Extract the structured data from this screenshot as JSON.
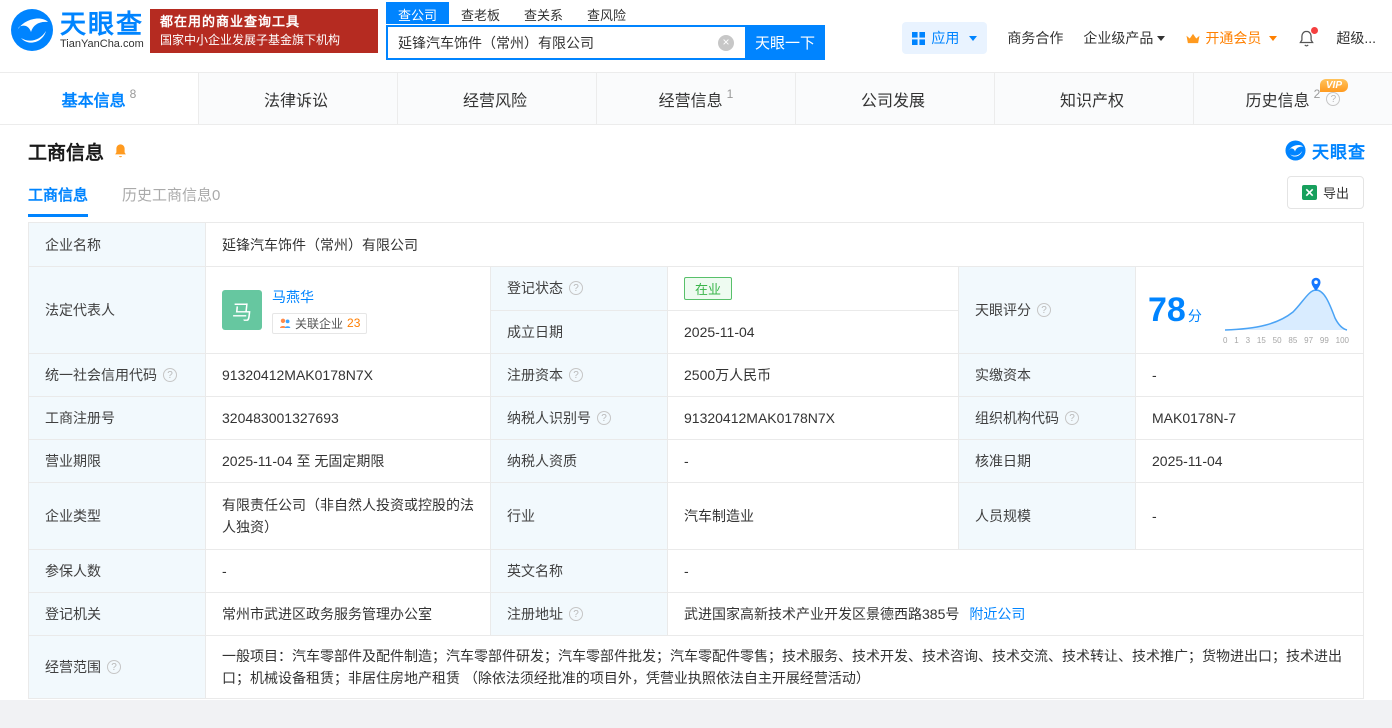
{
  "colors": {
    "brand_blue": "#0084ff",
    "slogan_red": "#b52b21",
    "vip_orange": "#ff9a1f",
    "status_green": "#39b54a"
  },
  "brand": {
    "name": "天眼查",
    "domain": "TianYanCha.com",
    "slogan1": "都在用的商业查询工具",
    "slogan2": "国家中小企业发展子基金旗下机构"
  },
  "search": {
    "tabs": [
      "查公司",
      "查老板",
      "查关系",
      "查风险"
    ],
    "value": "延锋汽车饰件（常州）有限公司",
    "button": "天眼一下"
  },
  "topnav": {
    "app": "应用",
    "cooperation": "商务合作",
    "enterprise": "企业级产品",
    "vip": "开通会员",
    "super": "超级..."
  },
  "tabs": [
    {
      "label": "基本信息",
      "count": "8"
    },
    {
      "label": "法律诉讼",
      "count": ""
    },
    {
      "label": "经营风险",
      "count": ""
    },
    {
      "label": "经营信息",
      "count": "1"
    },
    {
      "label": "公司发展",
      "count": ""
    },
    {
      "label": "知识产权",
      "count": ""
    },
    {
      "label": "历史信息",
      "count": "2",
      "vip": "VIP"
    }
  ],
  "section": {
    "title": "工商信息",
    "brand": "天眼查",
    "subtab_active": "工商信息",
    "subtab_history": "历史工商信息0",
    "export": "导出"
  },
  "info": {
    "company_name_label": "企业名称",
    "company_name": "延锋汽车饰件（常州）有限公司",
    "legal_rep_label": "法定代表人",
    "legal_rep_avatar": "马",
    "legal_rep_name": "马燕华",
    "related_label": "关联企业",
    "related_count": "23",
    "reg_status_label": "登记状态",
    "reg_status": "在业",
    "establish_label": "成立日期",
    "establish_date": "2025-11-04",
    "score_label": "天眼评分",
    "score": "78",
    "score_suffix": "分",
    "score_axis": [
      "0",
      "1",
      "3",
      "15",
      "50",
      "85",
      "97",
      "99",
      "100"
    ],
    "credit_code_label": "统一社会信用代码",
    "credit_code": "91320412MAK0178N7X",
    "reg_capital_label": "注册资本",
    "reg_capital": "2500万人民币",
    "paid_capital_label": "实缴资本",
    "paid_capital": "-",
    "reg_number_label": "工商注册号",
    "reg_number": "320483001327693",
    "taxpayer_id_label": "纳税人识别号",
    "taxpayer_id": "91320412MAK0178N7X",
    "org_code_label": "组织机构代码",
    "org_code": "MAK0178N-7",
    "term_label": "营业期限",
    "term": "2025-11-04 至 无固定期限",
    "taxpayer_quality_label": "纳税人资质",
    "taxpayer_quality": "-",
    "approval_label": "核准日期",
    "approval_date": "2025-11-04",
    "type_label": "企业类型",
    "company_type": "有限责任公司（非自然人投资或控股的法人独资）",
    "industry_label": "行业",
    "industry": "汽车制造业",
    "staff_label": "人员规模",
    "staff": "-",
    "insured_label": "参保人数",
    "insured": "-",
    "en_name_label": "英文名称",
    "en_name": "-",
    "authority_label": "登记机关",
    "authority": "常州市武进区政务服务管理办公室",
    "address_label": "注册地址",
    "address": "武进国家高新技术产业开发区景德西路385号",
    "nearby": "附近公司",
    "scope_label": "经营范围",
    "scope": "一般项目：汽车零部件及配件制造；汽车零部件研发；汽车零部件批发；汽车零配件零售；技术服务、技术开发、技术咨询、技术交流、技术转让、技术推广；货物进出口；技术进出口；机械设备租赁；非居住房地产租赁 （除依法须经批准的项目外，凭营业执照依法自主开展经营活动）"
  }
}
